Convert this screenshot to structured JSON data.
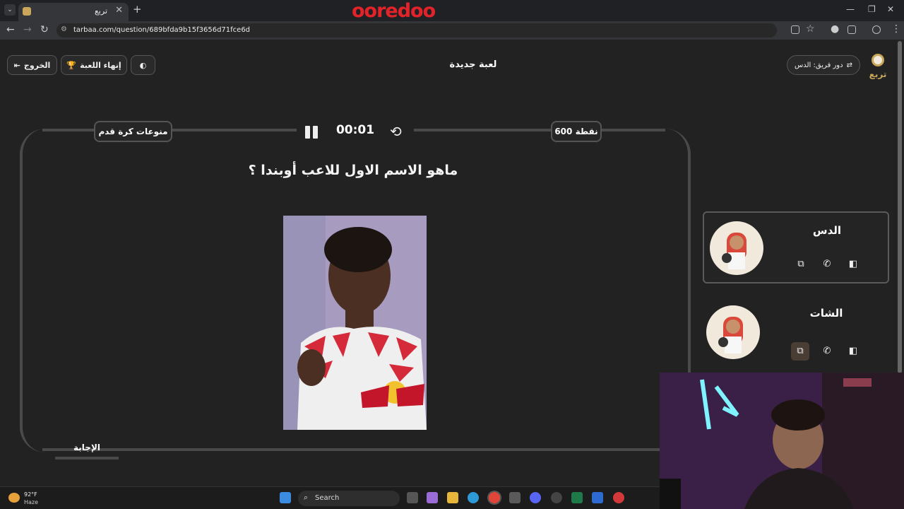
{
  "browser": {
    "tab_title": "تربع",
    "url": "tarbaa.com/question/689bfda9b15f3656d71fce6d",
    "brand": "ooredoo"
  },
  "header": {
    "exit_label": "الخروج",
    "end_game_label": "إنهاء اللعبة",
    "title": "لعبة جديدة",
    "turn_label": "دور فريق: الدس",
    "logo_text": "تربع"
  },
  "question": {
    "category": "منوعات كرة قدم",
    "points": "600 نقطة",
    "timer": "00:01",
    "text": "ماهو الاسم الاول للاعب أوبندا ؟",
    "answer_label": "الإجابة"
  },
  "teams": [
    {
      "name": "الدس"
    },
    {
      "name": "الشات"
    }
  ],
  "taskbar": {
    "weather_temp": "92°F",
    "weather_desc": "Haze",
    "search_label": "Search"
  },
  "colors": {
    "background": "#222222",
    "frame": "#4a4a4a",
    "brand_red": "#e3232a"
  }
}
